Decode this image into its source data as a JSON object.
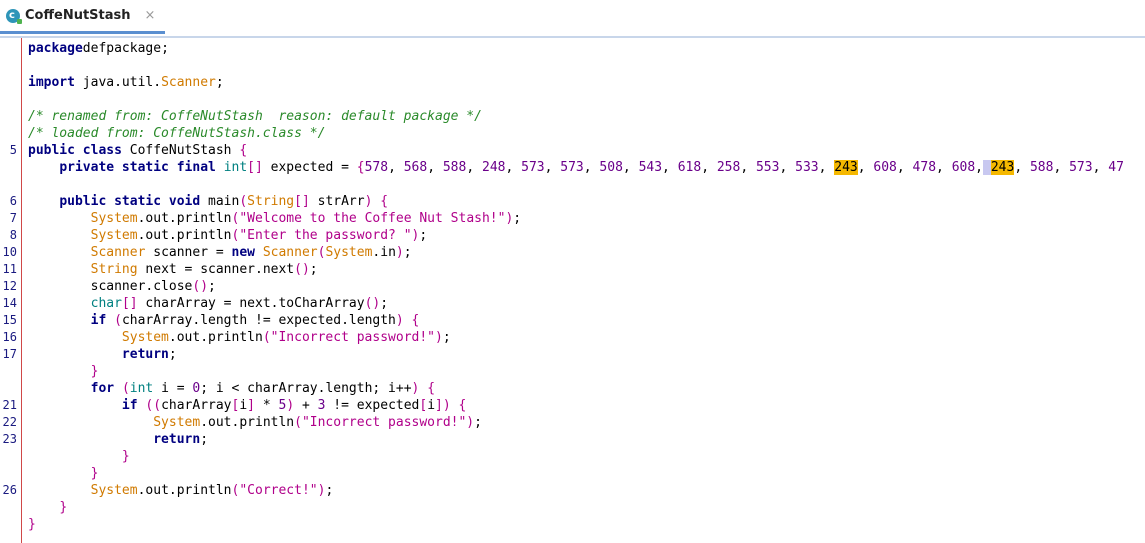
{
  "tab": {
    "title": "CoffeNutStash",
    "close": "×",
    "icon_letter": "c"
  },
  "lines": [
    {
      "ln": "",
      "tokens": [
        [
          "kw",
          "package"
        ],
        [
          "",
          "defpackage;"
        ]
      ]
    },
    {
      "ln": "",
      "tokens": []
    },
    {
      "ln": "",
      "tokens": [
        [
          "kw",
          "import"
        ],
        [
          "",
          " java.util."
        ],
        [
          "cls",
          "Scanner"
        ],
        [
          "",
          ";"
        ]
      ]
    },
    {
      "ln": "",
      "tokens": []
    },
    {
      "ln": "",
      "tokens": [
        [
          "cmt",
          "/* renamed from: CoffeNutStash  reason: default package */"
        ]
      ]
    },
    {
      "ln": "",
      "tokens": [
        [
          "cmt",
          "/* loaded from: CoffeNutStash.class */"
        ]
      ]
    },
    {
      "ln": "5",
      "tokens": [
        [
          "kw",
          "public class"
        ],
        [
          "",
          " CoffeNutStash "
        ],
        [
          "str",
          "{"
        ]
      ]
    },
    {
      "ln": "",
      "tokens": [
        [
          "",
          "    "
        ],
        [
          "kw",
          "private static final"
        ],
        [
          "",
          " "
        ],
        [
          "ty",
          "int"
        ],
        [
          "str",
          "[]"
        ],
        [
          "",
          " expected = "
        ],
        [
          "str",
          "{"
        ],
        [
          "num",
          "578"
        ],
        [
          "",
          ", "
        ],
        [
          "num",
          "568"
        ],
        [
          "",
          ", "
        ],
        [
          "num",
          "588"
        ],
        [
          "",
          ", "
        ],
        [
          "num",
          "248"
        ],
        [
          "",
          ", "
        ],
        [
          "num",
          "573"
        ],
        [
          "",
          ", "
        ],
        [
          "num",
          "573"
        ],
        [
          "",
          ", "
        ],
        [
          "num",
          "508"
        ],
        [
          "",
          ", "
        ],
        [
          "num",
          "543"
        ],
        [
          "",
          ", "
        ],
        [
          "num",
          "618"
        ],
        [
          "",
          ", "
        ],
        [
          "num",
          "258"
        ],
        [
          "",
          ", "
        ],
        [
          "num",
          "553"
        ],
        [
          "",
          ", "
        ],
        [
          "num",
          "533"
        ],
        [
          "",
          ", "
        ],
        [
          "hl",
          "243"
        ],
        [
          "",
          ", "
        ],
        [
          "num",
          "608"
        ],
        [
          "",
          ", "
        ],
        [
          "num",
          "478"
        ],
        [
          "",
          ", "
        ],
        [
          "num",
          "608"
        ],
        [
          "",
          ","
        ],
        [
          "hlsel",
          " "
        ],
        [
          "hl",
          "243"
        ],
        [
          "",
          ", "
        ],
        [
          "num",
          "588"
        ],
        [
          "",
          ", "
        ],
        [
          "num",
          "573"
        ],
        [
          "",
          ", "
        ],
        [
          "num",
          "47"
        ]
      ]
    },
    {
      "ln": "",
      "tokens": []
    },
    {
      "ln": "6",
      "tokens": [
        [
          "",
          "    "
        ],
        [
          "kw",
          "public static void"
        ],
        [
          "",
          " main"
        ],
        [
          "str",
          "("
        ],
        [
          "cls",
          "String"
        ],
        [
          "str",
          "[]"
        ],
        [
          "",
          " strArr"
        ],
        [
          "str",
          ")"
        ],
        [
          "",
          " "
        ],
        [
          "str",
          "{"
        ]
      ]
    },
    {
      "ln": "7",
      "tokens": [
        [
          "",
          "        "
        ],
        [
          "cls",
          "System"
        ],
        [
          "",
          ".out.println"
        ],
        [
          "str",
          "(\"Welcome to the Coffee Nut Stash!\")"
        ],
        [
          "",
          ";"
        ]
      ]
    },
    {
      "ln": "8",
      "tokens": [
        [
          "",
          "        "
        ],
        [
          "cls",
          "System"
        ],
        [
          "",
          ".out.println"
        ],
        [
          "str",
          "(\"Enter the password? \")"
        ],
        [
          "",
          ";"
        ]
      ]
    },
    {
      "ln": "10",
      "tokens": [
        [
          "",
          "        "
        ],
        [
          "cls",
          "Scanner"
        ],
        [
          "",
          " scanner = "
        ],
        [
          "kw",
          "new"
        ],
        [
          "",
          " "
        ],
        [
          "cls",
          "Scanner"
        ],
        [
          "str",
          "("
        ],
        [
          "cls",
          "System"
        ],
        [
          "",
          ".in"
        ],
        [
          "str",
          ")"
        ],
        [
          "",
          ";"
        ]
      ]
    },
    {
      "ln": "11",
      "tokens": [
        [
          "",
          "        "
        ],
        [
          "cls",
          "String"
        ],
        [
          "",
          " next = scanner.next"
        ],
        [
          "str",
          "()"
        ],
        [
          "",
          ";"
        ]
      ]
    },
    {
      "ln": "12",
      "tokens": [
        [
          "",
          "        scanner.close"
        ],
        [
          "str",
          "()"
        ],
        [
          "",
          ";"
        ]
      ]
    },
    {
      "ln": "14",
      "tokens": [
        [
          "",
          "        "
        ],
        [
          "ty",
          "char"
        ],
        [
          "str",
          "[]"
        ],
        [
          "",
          " charArray = next.toCharArray"
        ],
        [
          "str",
          "()"
        ],
        [
          "",
          ";"
        ]
      ]
    },
    {
      "ln": "15",
      "tokens": [
        [
          "",
          "        "
        ],
        [
          "kw",
          "if"
        ],
        [
          "",
          " "
        ],
        [
          "str",
          "("
        ],
        [
          "",
          "charArray.length != expected.length"
        ],
        [
          "str",
          ")"
        ],
        [
          "",
          " "
        ],
        [
          "str",
          "{"
        ]
      ]
    },
    {
      "ln": "16",
      "tokens": [
        [
          "",
          "            "
        ],
        [
          "cls",
          "System"
        ],
        [
          "",
          ".out.println"
        ],
        [
          "str",
          "(\"Incorrect password!\")"
        ],
        [
          "",
          ";"
        ]
      ]
    },
    {
      "ln": "17",
      "tokens": [
        [
          "",
          "            "
        ],
        [
          "kw",
          "return"
        ],
        [
          "",
          ";"
        ]
      ]
    },
    {
      "ln": "",
      "tokens": [
        [
          "",
          "        "
        ],
        [
          "str",
          "}"
        ]
      ]
    },
    {
      "ln": "",
      "tokens": [
        [
          "",
          "        "
        ],
        [
          "kw",
          "for"
        ],
        [
          "",
          " "
        ],
        [
          "str",
          "("
        ],
        [
          "ty",
          "int"
        ],
        [
          "",
          " i = "
        ],
        [
          "num",
          "0"
        ],
        [
          "",
          "; i < charArray.length; i++"
        ],
        [
          "str",
          ")"
        ],
        [
          "",
          " "
        ],
        [
          "str",
          "{"
        ]
      ]
    },
    {
      "ln": "21",
      "tokens": [
        [
          "",
          "            "
        ],
        [
          "kw",
          "if"
        ],
        [
          "",
          " "
        ],
        [
          "str",
          "(("
        ],
        [
          "",
          "charArray"
        ],
        [
          "str",
          "["
        ],
        [
          "",
          "i"
        ],
        [
          "str",
          "]"
        ],
        [
          "",
          " * "
        ],
        [
          "num",
          "5"
        ],
        [
          "str",
          ")"
        ],
        [
          "",
          " + "
        ],
        [
          "num",
          "3"
        ],
        [
          "",
          " != expected"
        ],
        [
          "str",
          "["
        ],
        [
          "",
          "i"
        ],
        [
          "str",
          "])"
        ],
        [
          "",
          " "
        ],
        [
          "str",
          "{"
        ]
      ]
    },
    {
      "ln": "22",
      "tokens": [
        [
          "",
          "                "
        ],
        [
          "cls",
          "System"
        ],
        [
          "",
          ".out.println"
        ],
        [
          "str",
          "(\"Incorrect password!\")"
        ],
        [
          "",
          ";"
        ]
      ]
    },
    {
      "ln": "23",
      "tokens": [
        [
          "",
          "                "
        ],
        [
          "kw",
          "return"
        ],
        [
          "",
          ";"
        ]
      ]
    },
    {
      "ln": "",
      "tokens": [
        [
          "",
          "            "
        ],
        [
          "str",
          "}"
        ]
      ]
    },
    {
      "ln": "",
      "tokens": [
        [
          "",
          "        "
        ],
        [
          "str",
          "}"
        ]
      ]
    },
    {
      "ln": "26",
      "tokens": [
        [
          "",
          "        "
        ],
        [
          "cls",
          "System"
        ],
        [
          "",
          ".out.println"
        ],
        [
          "str",
          "(\"Correct!\")"
        ],
        [
          "",
          ";"
        ]
      ]
    },
    {
      "ln": "",
      "tokens": [
        [
          "",
          "    "
        ],
        [
          "str",
          "}"
        ]
      ]
    },
    {
      "ln": "",
      "tokens": [
        [
          "str",
          "}"
        ]
      ]
    }
  ]
}
